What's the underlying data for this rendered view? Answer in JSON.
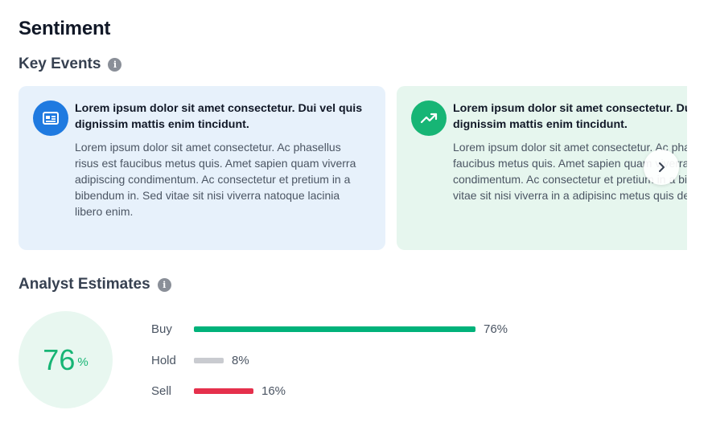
{
  "page": {
    "title": "Sentiment"
  },
  "key_events": {
    "title": "Key Events",
    "info_icon": "info-icon",
    "cards": [
      {
        "icon": "newspaper-icon",
        "color": "#1f7ae0",
        "background": "#e7f1fb",
        "headline": "Lorem ipsum dolor sit amet consectetur. Dui vel quis dignissim mattis enim tincidunt.",
        "body": "Lorem ipsum dolor sit amet consectetur. Ac phasellus risus est faucibus metus quis. Amet sapien quam viverra adipiscing condimentum. Ac consectetur et pretium in a bibendum in. Sed vitae sit nisi viverra natoque lacinia libero enim."
      },
      {
        "icon": "trending-up-icon",
        "color": "#17b575",
        "background": "#e6f6ee",
        "headline": "Lorem ipsum dolor sit amet consectetur. Dui vel quis dignissim mattis enim tincidunt.",
        "body": "Lorem ipsum dolor sit amet consectetur. Ac phasellus risus est faucibus metus quis. Amet sapien quam viverra adipiscing condimentum. Ac consectetur et pretium in a bibendum in. Sed vitae sit nisi viverra in a adipisinc metus quis del"
      }
    ],
    "next_icon": "chevron-right-icon"
  },
  "analyst_estimates": {
    "title": "Analyst Estimates",
    "info_icon": "info-icon",
    "gauge": {
      "value": "76",
      "unit": "%"
    },
    "ratings": [
      {
        "label": "Buy",
        "percent": 76,
        "display": "76%",
        "color": "#00b27a"
      },
      {
        "label": "Hold",
        "percent": 8,
        "display": "8%",
        "color": "#c9cbd0"
      },
      {
        "label": "Sell",
        "percent": 16,
        "display": "16%",
        "color": "#e5304c"
      }
    ]
  }
}
